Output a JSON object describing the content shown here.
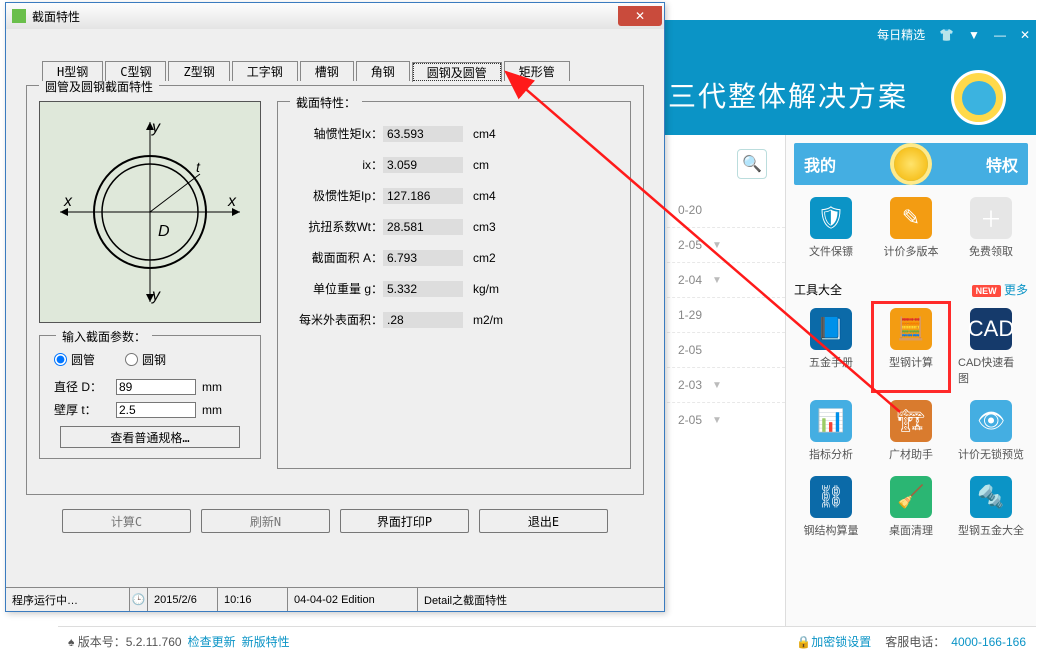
{
  "dialog": {
    "title": "截面特性",
    "tabs": [
      "H型钢",
      "C型钢",
      "Z型钢",
      "工字钢",
      "槽钢",
      "角钢",
      "圆钢及圆管",
      "矩形管"
    ],
    "selected_tab": "圆钢及圆管",
    "fieldset_title": "圆管及圆钢截面特性",
    "props_title": "截面特性：",
    "props": [
      {
        "label": "轴惯性矩Ix：",
        "value": "63.593",
        "unit": "cm4"
      },
      {
        "label": "ix：",
        "value": "3.059",
        "unit": "cm"
      },
      {
        "label": "极惯性矩Ip：",
        "value": "127.186",
        "unit": "cm4"
      },
      {
        "label": "抗扭系数Wt：",
        "value": "28.581",
        "unit": "cm3"
      },
      {
        "label": "截面面积 A：",
        "value": "6.793",
        "unit": "cm2"
      },
      {
        "label": "单位重量 g：",
        "value": "5.332",
        "unit": "kg/m"
      },
      {
        "label": "每米外表面积：",
        "value": ".28",
        "unit": "m2/m"
      }
    ],
    "input_title": "输入截面参数：",
    "radio_pipe": "圆管",
    "radio_bar": "圆钢",
    "diam_label": "直径 D：",
    "diam_value": "89",
    "diam_unit": "mm",
    "thick_label": "壁厚 t：",
    "thick_value": "2.5",
    "thick_unit": "mm",
    "look_btn": "查看普通规格…",
    "buttons": {
      "calc": "计算C",
      "refresh": "刷新N",
      "print": "界面打印P",
      "exit": "退出E"
    },
    "status": {
      "running": "程序运行中…",
      "date": "2015/2/6",
      "time": "10:16",
      "edition": "04-04-02 Edition",
      "ctx": "Detail之截面特性"
    }
  },
  "bg": {
    "topbar_daily": "每日精选",
    "slogan": "三代整体解决方案",
    "search_icon": "🔍",
    "dates": [
      "0-20",
      "2-05",
      "2-04",
      "1-29",
      "2-05",
      "2-03",
      "2-05"
    ],
    "my": "我的",
    "priv": "特权",
    "row1": [
      {
        "label": "文件保镖",
        "color": "#0b94c6",
        "glyph": "🛡"
      },
      {
        "label": "计价多版本",
        "color": "#f39c12",
        "glyph": "✎"
      },
      {
        "label": "免费领取",
        "color": "#e6e6e6",
        "glyph": "＋"
      }
    ],
    "tool_title": "工具大全",
    "new": "NEW",
    "more": "更多",
    "tools": [
      {
        "label": "五金手册",
        "color": "#0b6aa8",
        "glyph": "📘"
      },
      {
        "label": "型钢计算",
        "color": "#f39c12",
        "glyph": "🧮",
        "red": true
      },
      {
        "label": "CAD快速看图",
        "color": "#153a6b",
        "glyph": "CAD"
      },
      {
        "label": "指标分析",
        "color": "#44aee2",
        "glyph": "📊"
      },
      {
        "label": "广材助手",
        "color": "#d97b2e",
        "glyph": "🏗"
      },
      {
        "label": "计价无锁预览",
        "color": "#44aee2",
        "glyph": "👁"
      },
      {
        "label": "钢结构算量",
        "color": "#0b6aa8",
        "glyph": "⛓"
      },
      {
        "label": "桌面清理",
        "color": "#2bb673",
        "glyph": "🧹"
      },
      {
        "label": "型钢五金大全",
        "color": "#0b94c6",
        "glyph": "🔩"
      }
    ]
  },
  "footer": {
    "ver_label": "版本号：",
    "ver": "5.2.11.760",
    "check": "检查更新",
    "new": "新版特性",
    "lock": "加密锁设置",
    "tel_label": "客服电话：",
    "tel": "4000-166-166"
  }
}
